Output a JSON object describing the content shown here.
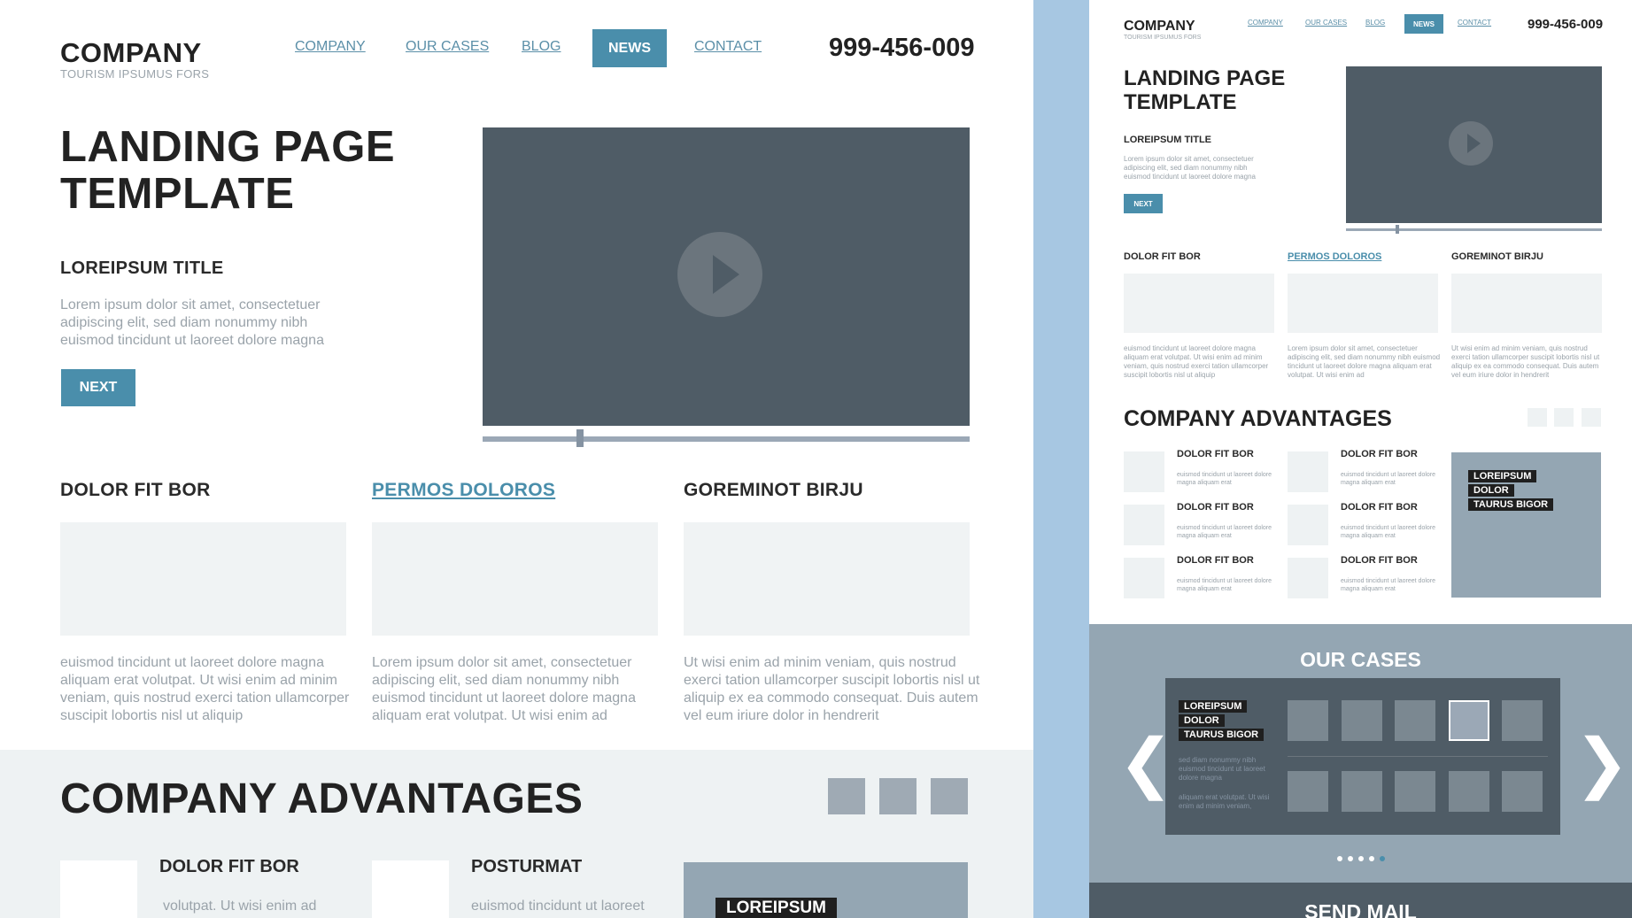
{
  "colors": {
    "accent": "#4a8eab",
    "background_blue": "#a7c7e2",
    "video": "#4f5c66",
    "gray_panel": "#94a6b3",
    "light_panel": "#f0f3f4"
  },
  "desktop": {
    "header": {
      "brand": "COMPANY",
      "tagline": "TOURISM IPSUMUS FORS",
      "nav": [
        "COMPANY",
        "OUR CASES",
        "BLOG",
        "NEWS",
        "CONTACT"
      ],
      "phone": "999-456-009"
    },
    "hero": {
      "title_line1": "LANDING PAGE",
      "title_line2": "TEMPLATE",
      "subtitle": "LOREIPSUM TITLE",
      "text": "Lorem ipsum dolor sit amet, consectetuer adipiscing elit, sed diam nonummy nibh euismod tincidunt ut laoreet dolore magna",
      "button": "NEXT",
      "video_icon": "play-icon",
      "progress": 0.2
    },
    "columns": [
      {
        "title": "DOLOR FIT BOR",
        "text": "euismod tincidunt ut laoreet dolore magna aliquam erat volutpat. Ut wisi enim ad minim veniam, quis nostrud exerci tation ullamcorper suscipit lobortis nisl ut aliquip"
      },
      {
        "title": "PERMOS DOLOROS",
        "text": "Lorem ipsum dolor sit amet, consectetuer adipiscing elit, sed diam nonummy nibh euismod tincidunt ut laoreet dolore magna aliquam erat volutpat. Ut wisi enim ad"
      },
      {
        "title": "GOREMINOT BIRJU",
        "text": "Ut wisi enim ad minim veniam, quis nostrud exerci tation ullamcorper suscipit lobortis nisl ut aliquip ex ea commodo consequat. Duis autem vel eum iriure dolor in hendrerit"
      }
    ],
    "advantages": {
      "title": "COMPANY ADVANTAGES",
      "items": [
        {
          "title": "DOLOR FIT BOR",
          "text": "volutpat. Ut wisi enim ad"
        },
        {
          "title": "POSTURMAT",
          "text": "euismod tincidunt ut laoreet"
        }
      ],
      "feature_tag": "LOREIPSUM"
    }
  },
  "mobile": {
    "header": {
      "brand": "COMPANY",
      "tagline": "TOURISM IPSUMUS FORS",
      "nav": [
        "COMPANY",
        "OUR CASES",
        "BLOG",
        "NEWS",
        "CONTACT"
      ],
      "phone": "999-456-009"
    },
    "hero": {
      "title_line1": "LANDING PAGE",
      "title_line2": "TEMPLATE",
      "subtitle": "LOREIPSUM TITLE",
      "text": "Lorem ipsum dolor sit amet, consectetuer adipiscing elit, sed diam nonummy nibh euismod tincidunt ut laoreet dolore magna",
      "button": "NEXT",
      "progress": 0.2
    },
    "columns": [
      {
        "title": "DOLOR FIT BOR",
        "text": "euismod tincidunt ut laoreet dolore magna aliquam erat volutpat. Ut wisi enim ad minim veniam, quis nostrud exerci tation ullamcorper suscipit lobortis nisl ut aliquip"
      },
      {
        "title": "PERMOS DOLOROS",
        "text": "Lorem ipsum dolor sit amet, consectetuer adipiscing elit, sed diam nonummy nibh euismod tincidunt ut laoreet dolore magna aliquam erat volutpat. Ut wisi enim ad"
      },
      {
        "title": "GOREMINOT BIRJU",
        "text": "Ut wisi enim ad minim veniam, quis nostrud exerci tation ullamcorper suscipit lobortis nisl ut aliquip ex ea commodo consequat. Duis autem vel eum iriure dolor in hendrerit"
      }
    ],
    "advantages": {
      "title": "COMPANY ADVANTAGES",
      "items": [
        {
          "title": "DOLOR FIT BOR",
          "text": "euismod tincidunt ut laoreet dolore magna aliquam erat"
        },
        {
          "title": "DOLOR FIT BOR",
          "text": "euismod tincidunt ut laoreet dolore magna aliquam erat"
        },
        {
          "title": "DOLOR FIT BOR",
          "text": "euismod tincidunt ut laoreet dolore magna aliquam erat"
        },
        {
          "title": "DOLOR FIT BOR",
          "text": "euismod tincidunt ut laoreet dolore magna aliquam erat"
        },
        {
          "title": "DOLOR FIT BOR",
          "text": "euismod tincidunt ut laoreet dolore magna aliquam erat"
        },
        {
          "title": "DOLOR FIT BOR",
          "text": "euismod tincidunt ut laoreet dolore magna aliquam erat"
        }
      ],
      "feature_tags": [
        "LOREIPSUM",
        "DOLOR",
        "TAURUS BIGOR"
      ]
    },
    "cases": {
      "title": "OUR CASES",
      "tags": [
        "LOREIPSUM",
        "DOLOR",
        "TAURUS BIGOR"
      ],
      "text1": "sed diam nonummy nibh euismod tincidunt ut laoreet dolore magna",
      "text2": "aliquam erat volutpat. Ut wisi enim ad minim veniam,",
      "prev_icon": "chevron-left-icon",
      "next_icon": "chevron-right-icon",
      "prev_glyph": "❮",
      "next_glyph": "❯",
      "thumbnails_per_row": 5,
      "active_thumbnail": 3,
      "dots": 5,
      "active_dot": 4
    },
    "send_mail": {
      "title": "SEND MAIL"
    }
  }
}
